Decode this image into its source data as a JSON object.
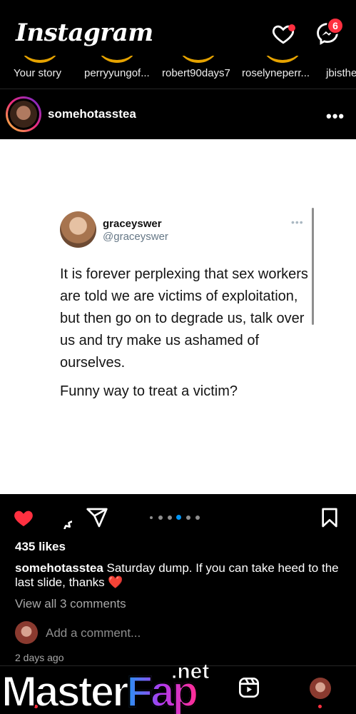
{
  "header": {
    "logo": "Instagram",
    "message_badge": "6"
  },
  "stories": [
    {
      "label": "Your story"
    },
    {
      "label": "perryyungof..."
    },
    {
      "label": "robert90days7"
    },
    {
      "label": "roselyneperr..."
    },
    {
      "label": "jbisthe"
    }
  ],
  "post": {
    "username": "somehotasstea",
    "more": "•••",
    "tweet": {
      "name": "graceyswer",
      "handle": "@graceyswer",
      "dots": "•••",
      "text": "It is forever perplexing that sex workers are told we are victims of exploitation, but then go on to degrade us, talk over us and try make us ashamed of ourselves.",
      "text2": "Funny way to treat a victim?"
    },
    "carousel": {
      "count": 6,
      "active_index": 3
    },
    "likes": "435 likes",
    "caption_user": "somehotasstea",
    "caption_text": " Saturday dump. If you can take heed to the last slide, thanks ❤️",
    "view_comments": "View all 3 comments",
    "add_comment_placeholder": "Add a comment...",
    "timestamp": "2 days ago"
  },
  "watermark": {
    "master": "Master",
    "fap": "Fap",
    "net": ".net"
  },
  "colors": {
    "background": "#000000",
    "like_red": "#ff3040",
    "muted_text": "#a8a8a8",
    "active_dot": "#0095f6"
  }
}
